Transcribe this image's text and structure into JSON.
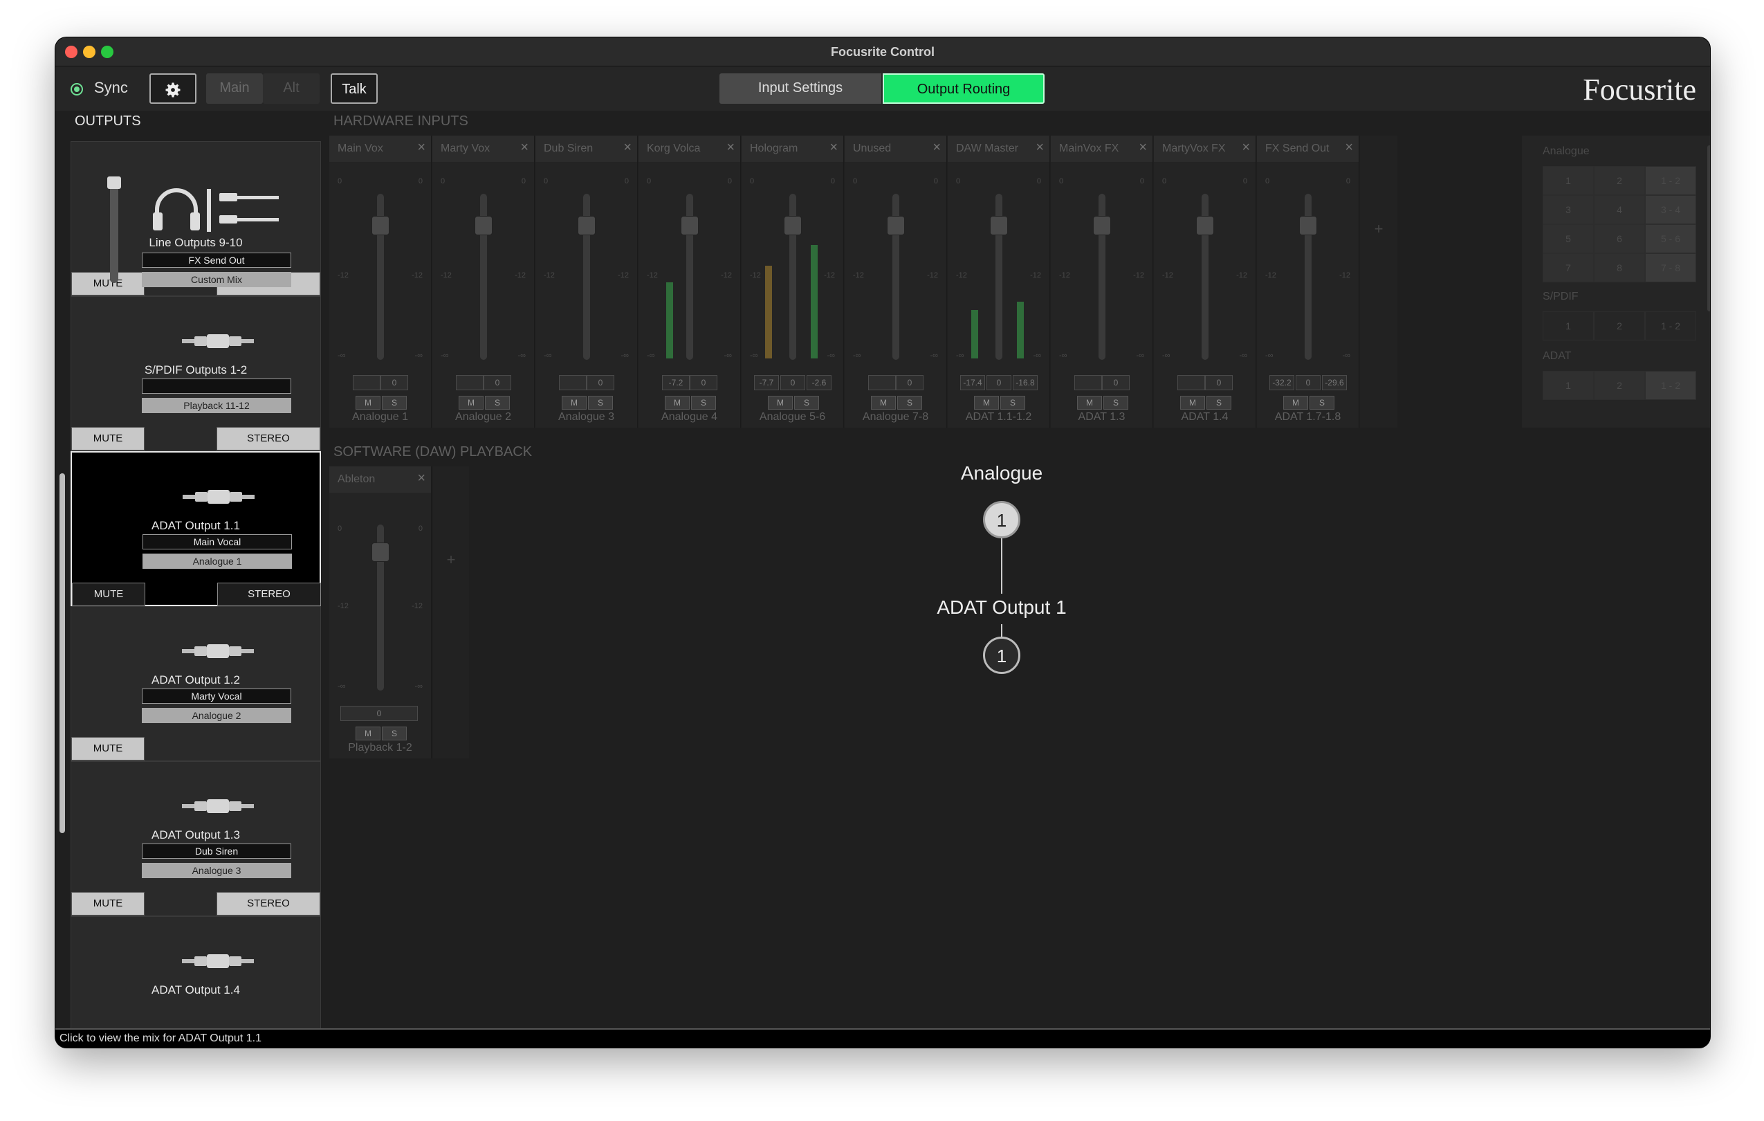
{
  "window": {
    "title": "Focusrite Control"
  },
  "toolbar": {
    "sync_label": "Sync",
    "settings_icon": "gear-icon",
    "main_label": "Main",
    "alt_label": "Alt",
    "talk_label": "Talk",
    "tab_input": "Input Settings",
    "tab_output": "Output Routing",
    "active_tab": "Output Routing",
    "brand": "Focusrite"
  },
  "colors": {
    "accent": "#19e36b",
    "sync": "#6fe094"
  },
  "outputs": {
    "title": "OUTPUTS",
    "cards": [
      {
        "name": "Line Outputs 9-10",
        "mix": "FX Send Out",
        "source": "Custom Mix",
        "mute": "MUTE",
        "stereo": "STEREO",
        "icon": "headphones-line-icon"
      },
      {
        "name": "S/PDIF Outputs 1-2",
        "mix": "",
        "source": "Playback 11-12",
        "mute": "MUTE",
        "stereo": "STEREO",
        "icon": "jack-icon"
      },
      {
        "name": "ADAT Output 1.1",
        "mix": "Main Vocal",
        "source": "Analogue 1",
        "mute": "MUTE",
        "stereo": "STEREO",
        "icon": "jack-icon",
        "selected": true
      },
      {
        "name": "ADAT Output 1.2",
        "mix": "Marty Vocal",
        "source": "Analogue 2",
        "mute": "MUTE",
        "stereo": "",
        "icon": "jack-icon"
      },
      {
        "name": "ADAT Output 1.3",
        "mix": "Dub Siren",
        "source": "Analogue 3",
        "mute": "MUTE",
        "stereo": "STEREO",
        "icon": "jack-icon"
      },
      {
        "name": "ADAT Output 1.4",
        "icon": "jack-icon"
      }
    ]
  },
  "hardware": {
    "title": "HARDWARE INPUTS",
    "strips": [
      {
        "label": "Main Vox",
        "foot": "Analogue 1",
        "vals": [
          "",
          "0"
        ]
      },
      {
        "label": "Marty Vox",
        "foot": "Analogue 2",
        "vals": [
          "",
          "0"
        ]
      },
      {
        "label": "Dub Siren",
        "foot": "Analogue 3",
        "vals": [
          "",
          "0"
        ]
      },
      {
        "label": "Korg Volca",
        "foot": "Analogue 4",
        "vals": [
          "-7.2",
          "0"
        ]
      },
      {
        "label": "Hologram",
        "foot": "Analogue 5-6",
        "vals": [
          "-7.7",
          "0",
          "-2.6"
        ]
      },
      {
        "label": "Unused",
        "foot": "Analogue 7-8",
        "vals": [
          "",
          "0"
        ]
      },
      {
        "label": "DAW Master",
        "foot": "ADAT 1.1-1.2",
        "vals": [
          "-17.4",
          "0",
          "-16.8"
        ]
      },
      {
        "label": "MainVox FX",
        "foot": "ADAT 1.3",
        "vals": [
          "",
          "0"
        ]
      },
      {
        "label": "MartyVox FX",
        "foot": "ADAT 1.4",
        "vals": [
          "",
          "0"
        ]
      },
      {
        "label": "FX Send Out",
        "foot": "ADAT 1.7-1.8",
        "vals": [
          "-32.2",
          "0",
          "-29.6"
        ]
      }
    ],
    "ticks": [
      "0",
      "-12",
      "-∞"
    ],
    "mute_label": "M",
    "solo_label": "S"
  },
  "daw": {
    "title": "SOFTWARE (DAW) PLAYBACK",
    "strips": [
      {
        "label": "Ableton",
        "foot": "Playback 1-2",
        "vals": [
          "0"
        ]
      }
    ]
  },
  "routing": {
    "source_group": "Analogue",
    "source_num": "1",
    "dest_label": "ADAT Output 1",
    "dest_num": "1"
  },
  "right_panel": {
    "analogue_title": "Analogue",
    "analogue_cells": [
      [
        "1",
        "2",
        "1 - 2"
      ],
      [
        "3",
        "4",
        "3 - 4"
      ],
      [
        "5",
        "6",
        "5 - 6"
      ],
      [
        "7",
        "8",
        "7 - 8"
      ]
    ],
    "spdif_title": "S/PDIF",
    "spdif_cells": [
      "1",
      "2",
      "1 - 2"
    ],
    "adat_title": "ADAT",
    "adat_cells": [
      "1",
      "2",
      "1 - 2"
    ]
  },
  "status": {
    "text": "Click to view the mix for ADAT Output 1.1"
  }
}
